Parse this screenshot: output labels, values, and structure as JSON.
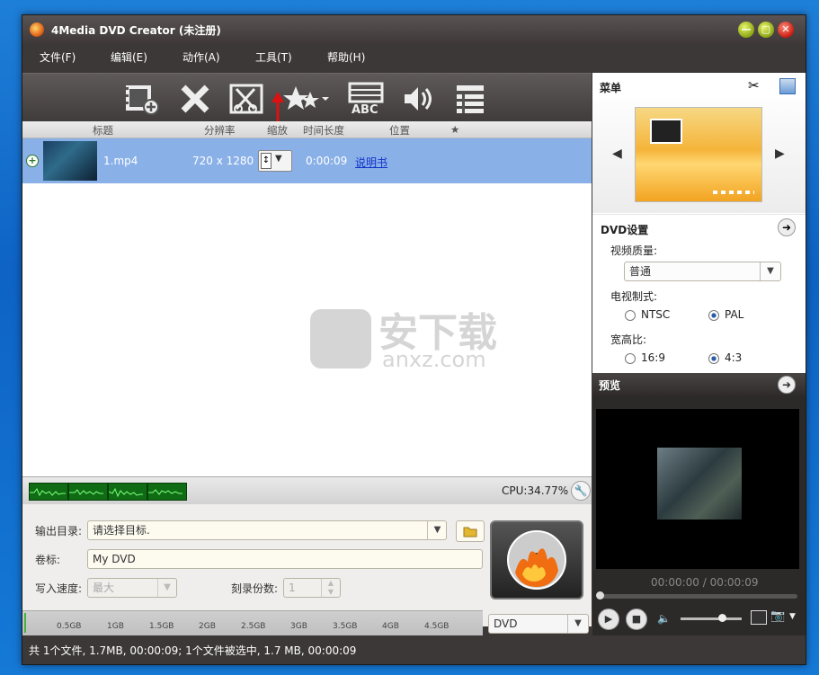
{
  "window": {
    "title": "4Media DVD Creator (未注册)"
  },
  "menu": [
    "文件(F)",
    "编辑(E)",
    "动作(A)",
    "工具(T)",
    "帮助(H)"
  ],
  "columns": {
    "title": "标题",
    "resolution": "分辨率",
    "zoom": "缩放",
    "duration": "时间长度",
    "position": "位置",
    "star": "★"
  },
  "file_row": {
    "name": "1.mp4",
    "resolution": "720 x 1280",
    "duration": "0:00:09",
    "manual_link": "说明书"
  },
  "watermark": {
    "cn": "安下载",
    "en": "anxz.com"
  },
  "cpu": {
    "label": "CPU:34.77%"
  },
  "form": {
    "output_dir_label": "输出目录:",
    "output_dir_value": "请选择目标.",
    "volume_label": "卷标:",
    "volume_value": "My DVD",
    "write_speed_label": "写入速度:",
    "write_speed_value": "最大",
    "copies_label": "刻录份数:",
    "copies_value": "1"
  },
  "gauge": {
    "labels": [
      "0.5GB",
      "1GB",
      "1.5GB",
      "2GB",
      "2.5GB",
      "3GB",
      "3.5GB",
      "4GB",
      "4.5GB"
    ],
    "disc_type": "DVD"
  },
  "status": {
    "text": "共 1个文件, 1.7MB,  00:00:09; 1个文件被选中, 1.7 MB,  00:00:09"
  },
  "menu_panel": {
    "title": "菜单"
  },
  "dvd_settings": {
    "title": "DVD设置",
    "quality_label": "视频质量:",
    "quality_value": "普通",
    "tv_label": "电视制式:",
    "ntsc": "NTSC",
    "pal": "PAL",
    "tv_selected": "PAL",
    "aspect_label": "宽高比:",
    "a169": "16:9",
    "a43": "4:3",
    "aspect_selected": "4:3"
  },
  "preview": {
    "title": "预览",
    "time": "00:00:00 / 00:00:09"
  },
  "colors": {
    "selected_row": "#8ab0e8",
    "window": "#3d3838"
  }
}
